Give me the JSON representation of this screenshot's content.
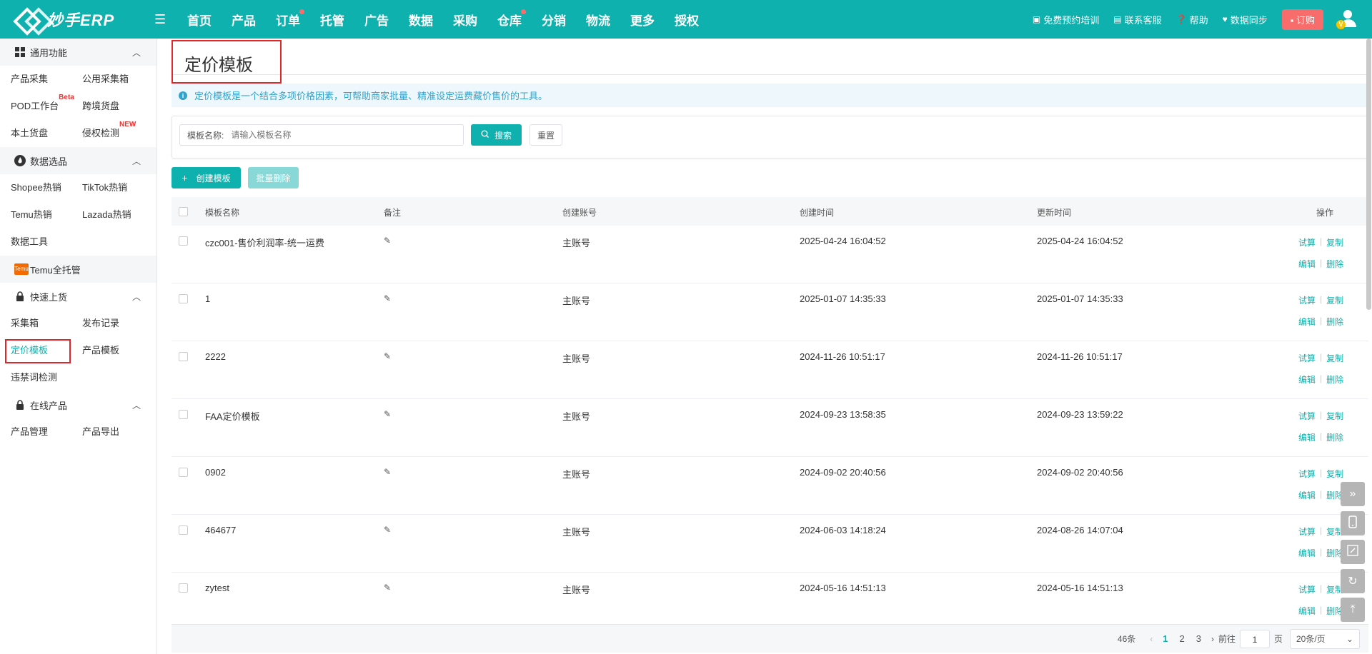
{
  "app": {
    "logo_text": "妙手ERP"
  },
  "nav": [
    "首页",
    "产品",
    "订单",
    "托管",
    "广告",
    "数据",
    "采购",
    "仓库",
    "分销",
    "物流",
    "更多",
    "授权"
  ],
  "tools": {
    "training": "免费预约培训",
    "support": "联系客服",
    "help": "帮助",
    "sync": "数据同步",
    "order": "订购",
    "vip": "V"
  },
  "sidebar": {
    "general": {
      "title": "通用功能",
      "items": [
        "产品采集",
        "公用采集箱",
        "POD工作台",
        "跨境货盘",
        "本土货盘",
        "侵权检测"
      ],
      "beta": "Beta",
      "new": "NEW"
    },
    "data": {
      "title": "数据选品",
      "items": [
        "Shopee热销",
        "TikTok热销",
        "Temu热销",
        "Lazada热销",
        "数据工具"
      ]
    },
    "temu": {
      "badge": "Temu",
      "label": "Temu全托管"
    },
    "quick": {
      "title": "快速上货",
      "items": [
        "采集箱",
        "发布记录",
        "定价模板",
        "产品模板",
        "违禁词检测"
      ]
    },
    "online": {
      "title": "在线产品",
      "items": [
        "产品管理",
        "产品导出"
      ]
    }
  },
  "page": {
    "title": "定价模板",
    "notice": "定价模板是一个结合多项价格因素，可帮助商家批量、精准设定运费藏价售价的工具。",
    "filter": {
      "label": "模板名称:",
      "placeholder": "请输入模板名称",
      "search": "搜索",
      "reset": "重置"
    },
    "create": "创建模板",
    "batch_delete": "批量删除"
  },
  "table": {
    "headers": {
      "name": "模板名称",
      "note": "备注",
      "account": "创建账号",
      "created": "创建时间",
      "updated": "更新时间",
      "ops": "操作"
    },
    "ops": {
      "trial": "试算",
      "copy": "复制",
      "edit": "编辑",
      "delete": "删除"
    },
    "rows": [
      {
        "name": "czc001-售价利润率-统一运费",
        "account": "主账号",
        "created": "2025-04-24 16:04:52",
        "updated": "2025-04-24 16:04:52"
      },
      {
        "name": "1",
        "account": "主账号",
        "created": "2025-01-07 14:35:33",
        "updated": "2025-01-07 14:35:33"
      },
      {
        "name": "2222",
        "account": "主账号",
        "created": "2024-11-26 10:51:17",
        "updated": "2024-11-26 10:51:17"
      },
      {
        "name": "FAA定价模板",
        "account": "主账号",
        "created": "2024-09-23 13:58:35",
        "updated": "2024-09-23 13:59:22"
      },
      {
        "name": "0902",
        "account": "主账号",
        "created": "2024-09-02 20:40:56",
        "updated": "2024-09-02 20:40:56"
      },
      {
        "name": "464677",
        "account": "主账号",
        "created": "2024-06-03 14:18:24",
        "updated": "2024-08-26 14:07:04"
      },
      {
        "name": "zytest",
        "account": "主账号",
        "created": "2024-05-16 14:51:13",
        "updated": "2024-05-16 14:51:13"
      }
    ]
  },
  "pager": {
    "total": "46条",
    "pages": [
      "1",
      "2",
      "3"
    ],
    "goto": "前往",
    "page_value": "1",
    "page_unit": "页",
    "size": "20条/页"
  },
  "colors": {
    "primary": "#0eb1ad",
    "danger": "#e0252b"
  }
}
